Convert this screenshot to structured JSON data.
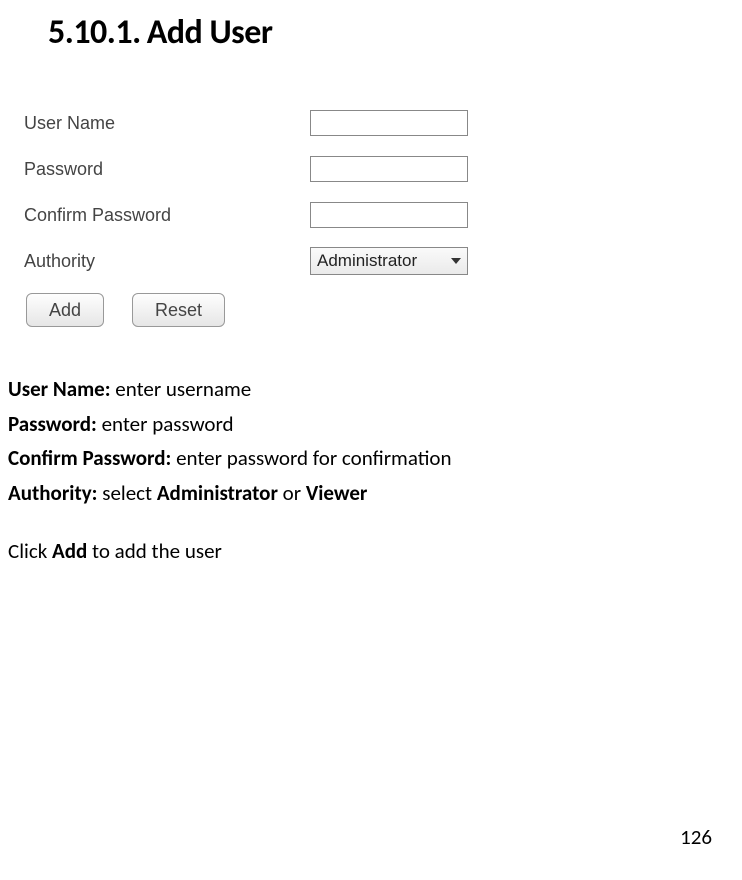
{
  "heading": {
    "number": "5.10.1.",
    "title": "Add User"
  },
  "form": {
    "username_label": "User Name",
    "username_value": "",
    "password_label": "Password",
    "password_value": "",
    "confirm_label": "Confirm Password",
    "confirm_value": "",
    "authority_label": "Authority",
    "authority_selected": "Administrator"
  },
  "buttons": {
    "add": "Add",
    "reset": "Reset"
  },
  "descriptions": {
    "username_term": "User Name:",
    "username_desc": " enter username",
    "password_term": "Password:",
    "password_desc": " enter password",
    "confirm_term": "Confirm Password:",
    "confirm_desc": " enter password for confirmation",
    "authority_term": "Authority:",
    "authority_desc_pre": " select ",
    "authority_opt1": "Administrator",
    "authority_desc_mid": " or ",
    "authority_opt2": "Viewer",
    "click_pre": "Click ",
    "click_add": "Add",
    "click_post": " to add the user"
  },
  "page_number": "126"
}
